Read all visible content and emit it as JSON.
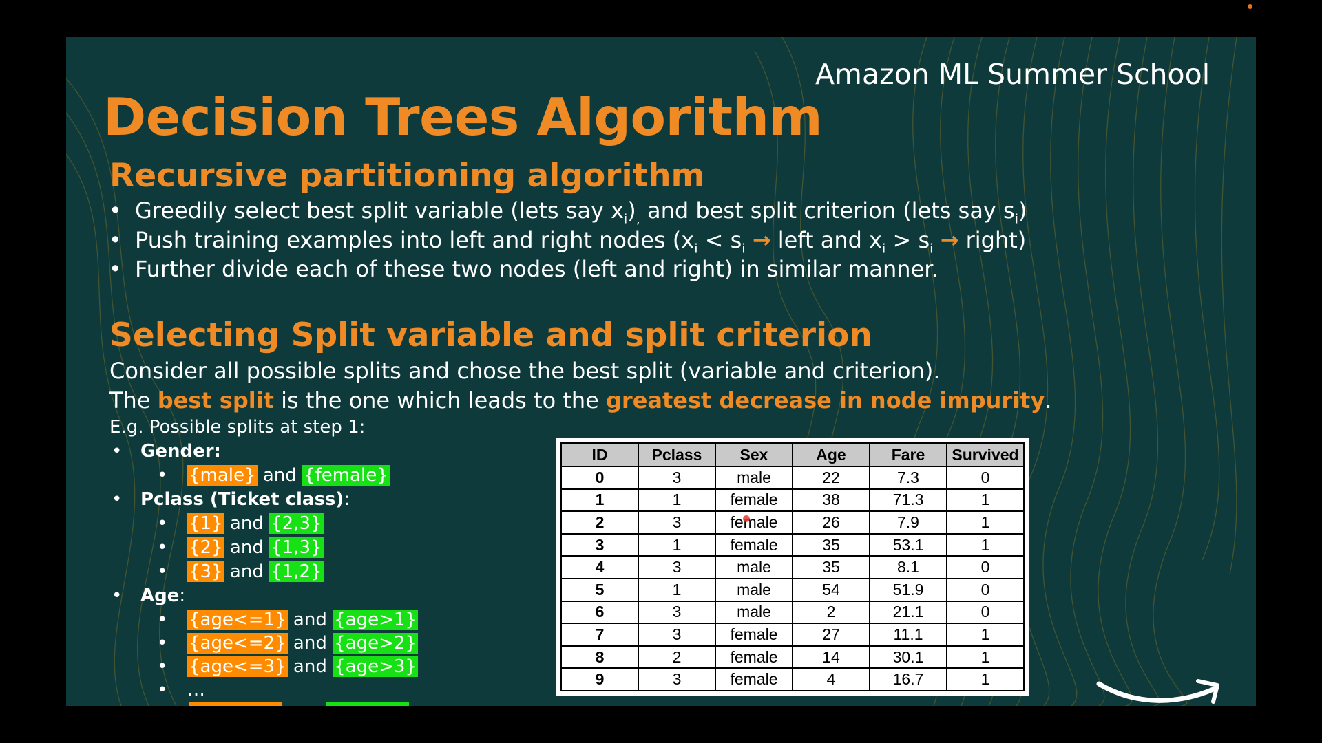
{
  "brand": "Amazon ML Summer School",
  "title": "Decision Trees Algorithm",
  "section1": {
    "heading": "Recursive partitioning algorithm",
    "b1_pre": "Greedily select best split variable (lets say x",
    "b1_sub1": "i",
    "b1_mid": ")",
    "b1_comma": ",",
    "b1_mid2": " and best split criterion (lets say s",
    "b1_sub2": "i",
    "b1_end": ")",
    "b2_pre": "Push training examples into left and right nodes (x",
    "b2_s1": "i",
    "b2_lt": " < s",
    "b2_s2": "i",
    "b2_arrow": "→",
    "b2_left": " left and x",
    "b2_s3": "i",
    "b2_gt": " > s",
    "b2_s4": "i",
    "b2_arrow2": "→",
    "b2_right": " right)",
    "b3": "Further divide each of these two nodes (left and right) in similar manner."
  },
  "section2": {
    "heading": "Selecting Split variable and split criterion",
    "p1": "Consider all possible splits and chose the best split (variable and criterion).",
    "p2_pre": "The ",
    "p2_hl1": "best split",
    "p2_mid": " is the one which leads to the ",
    "p2_hl2": "greatest decrease in node impurity",
    "p2_end": ".",
    "eg": "E.g. Possible splits at step 1:"
  },
  "splits": {
    "bullet": "•",
    "and": "and",
    "gender_label": "Gender:",
    "gender": {
      "a": "{male}",
      "b": "{female}"
    },
    "pclass_label": "Pclass (Ticket class)",
    "pclass_colon": ":",
    "pclass": [
      {
        "a": "{1}",
        "b": "{2,3}"
      },
      {
        "a": "{2}",
        "b": "{1,3}"
      },
      {
        "a": "{3}",
        "b": "{1,2}"
      }
    ],
    "age_label": "Age",
    "age_colon": ":",
    "age": [
      {
        "a": "{age<=1}",
        "b": "{age>1}"
      },
      {
        "a": "{age<=2}",
        "b": "{age>2}"
      },
      {
        "a": "{age<=3}",
        "b": "{age>3}"
      }
    ],
    "ellipsis": "…"
  },
  "table": {
    "headers": [
      "ID",
      "Pclass",
      "Sex",
      "Age",
      "Fare",
      "Survived"
    ],
    "rows": [
      [
        "0",
        "3",
        "male",
        "22",
        "7.3",
        "0"
      ],
      [
        "1",
        "1",
        "female",
        "38",
        "71.3",
        "1"
      ],
      [
        "2",
        "3",
        "female",
        "26",
        "7.9",
        "1"
      ],
      [
        "3",
        "1",
        "female",
        "35",
        "53.1",
        "1"
      ],
      [
        "4",
        "3",
        "male",
        "35",
        "8.1",
        "0"
      ],
      [
        "5",
        "1",
        "male",
        "54",
        "51.9",
        "0"
      ],
      [
        "6",
        "3",
        "male",
        "2",
        "21.1",
        "0"
      ],
      [
        "7",
        "3",
        "female",
        "27",
        "11.1",
        "1"
      ],
      [
        "8",
        "2",
        "female",
        "14",
        "30.1",
        "1"
      ],
      [
        "9",
        "3",
        "female",
        "4",
        "16.7",
        "1"
      ]
    ]
  },
  "colors": {
    "slide_bg": "#0f3a3b",
    "accent_orange": "#f08a24",
    "highlight_orange": "#ff8c00",
    "highlight_green": "#17e014",
    "text": "#ffffff",
    "table_header_bg": "#c9c9c9"
  },
  "icons": {
    "logo": "amazon-smile-logo-icon",
    "recording": "recording-indicator-icon"
  }
}
